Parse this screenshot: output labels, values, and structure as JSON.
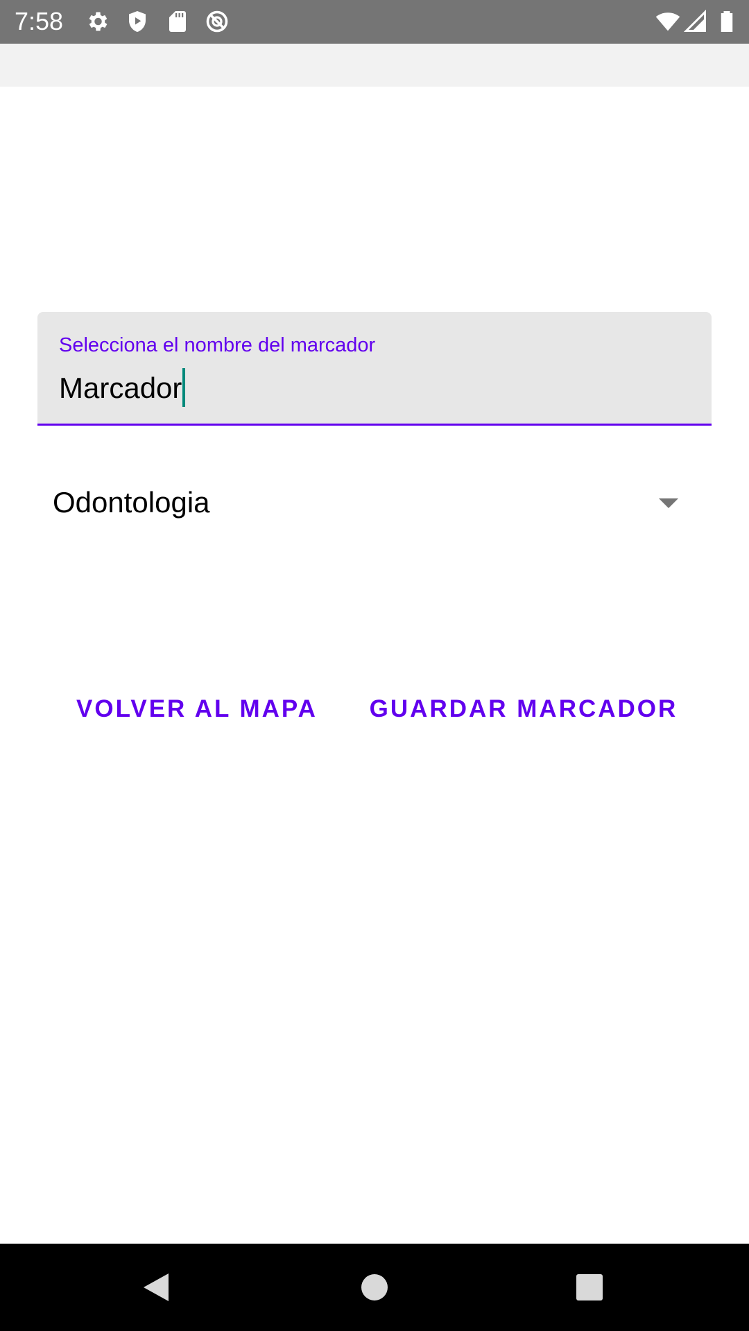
{
  "status_bar": {
    "time": "7:58",
    "icons_left": [
      "settings-gear-icon",
      "shield-play-icon",
      "sd-card-icon",
      "no-disturb-icon"
    ],
    "icons_right": [
      "wifi-icon",
      "cell-signal-icon",
      "battery-icon"
    ]
  },
  "form": {
    "name_field": {
      "label": "Selecciona el nombre del marcador",
      "value": "Marcador"
    },
    "category_spinner": {
      "selected": "Odontologia"
    },
    "buttons": {
      "back_label": "VOLVER AL MAPA",
      "save_label": "GUARDAR MARCADOR"
    }
  },
  "colors": {
    "accent": "#6200ee",
    "caret": "#00897b",
    "status_bar": "#757575",
    "field_background": "#e7e7e7"
  },
  "nav_bar": {
    "icons": [
      "back-triangle-icon",
      "home-circle-icon",
      "recents-square-icon"
    ]
  }
}
